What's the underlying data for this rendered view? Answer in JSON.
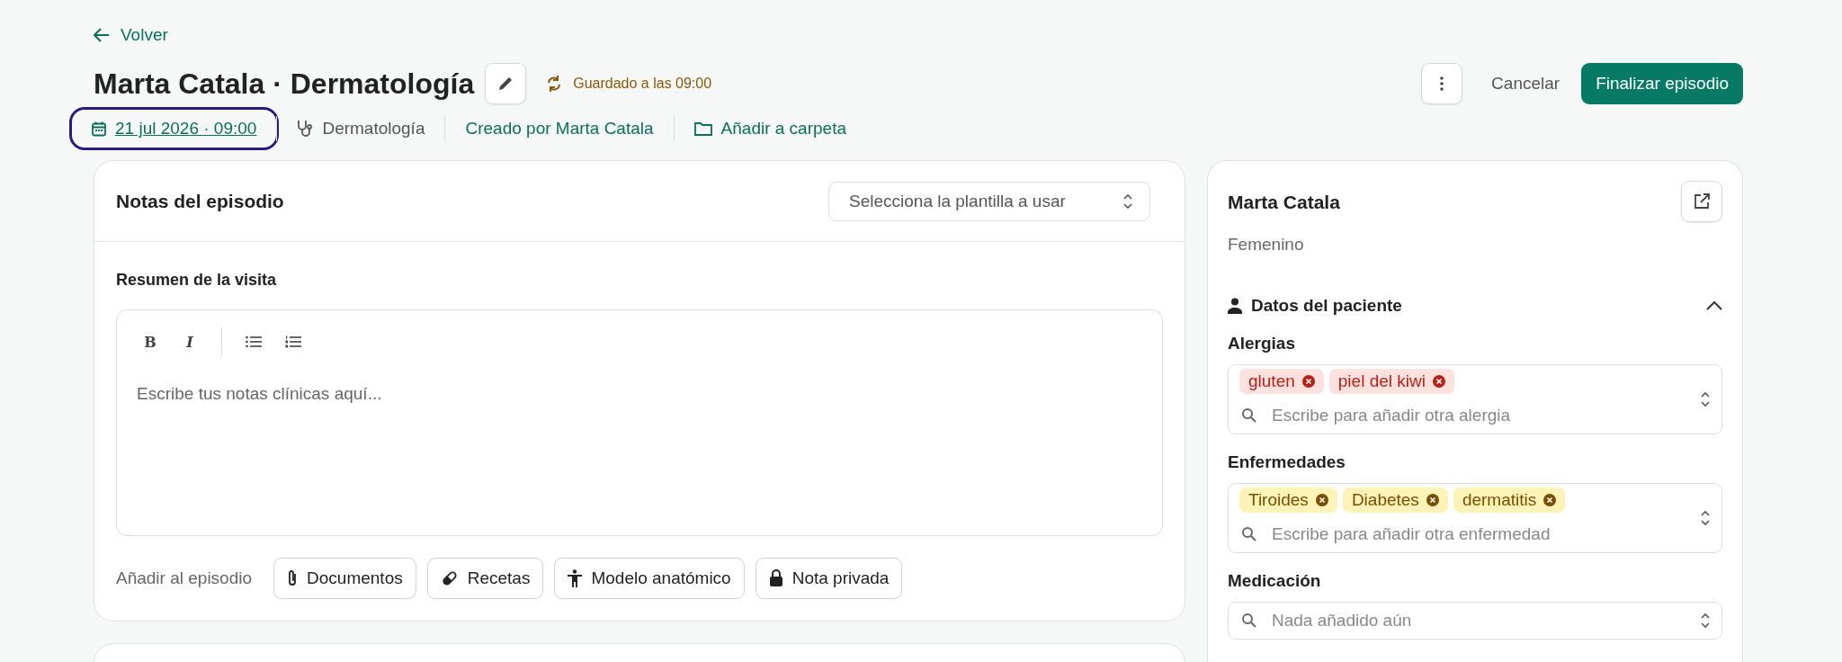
{
  "back_link": {
    "label": "Volver"
  },
  "header": {
    "title": "Marta Catala · Dermatología",
    "save_status": "Guardado a las 09:00",
    "actions": {
      "cancel": "Cancelar",
      "primary": "Finalizar episodio"
    }
  },
  "meta": [
    {
      "kind": "date",
      "label": "21 jul 2026 · 09:00",
      "focused": true
    },
    {
      "kind": "specialty",
      "label": "Dermatología",
      "focused": false
    },
    {
      "kind": "author",
      "label": "Creado por Marta Catala",
      "focused": false
    },
    {
      "kind": "folder",
      "label": "Añadir a carpeta",
      "focused": false
    }
  ],
  "notes_card": {
    "title": "Notas del episodio",
    "template_select": {
      "placeholder": "Selecciona la plantilla a usar"
    },
    "section_label": "Resumen de la visita",
    "editor": {
      "toolbar": [
        {
          "kind": "bold",
          "label": "B"
        },
        {
          "kind": "italic",
          "label": "I"
        },
        {
          "kind": "bullets"
        },
        {
          "kind": "numbered"
        }
      ],
      "placeholder": "Escribe tus notas clínicas aquí..."
    },
    "attach_label": "Añadir al episodio",
    "attach_buttons": [
      {
        "kind": "clip",
        "label": "Documentos"
      },
      {
        "kind": "pill",
        "label": "Recetas"
      },
      {
        "kind": "body",
        "label": "Modelo anatómico"
      },
      {
        "kind": "lock",
        "label": "Nota privada"
      }
    ]
  },
  "patient_card": {
    "name": "Marta Catala",
    "sex": "Femenino",
    "section": {
      "title": "Datos del paciente",
      "expanded": true
    },
    "fields": [
      {
        "label": "Alergias",
        "tags": [
          {
            "label": "gluten",
            "color": "#fde1df"
          },
          {
            "label": "piel del kiwi",
            "color": "#fde1df"
          }
        ],
        "placeholder": "Escribe para añadir otra alergia"
      },
      {
        "label": "Enfermedades",
        "tags": [
          {
            "label": "Tiroides",
            "color": "#fdf3b8"
          },
          {
            "label": "Diabetes",
            "color": "#fdf3b8"
          },
          {
            "label": "dermatitis",
            "color": "#fdf3b8"
          }
        ],
        "placeholder": "Escribe para añadir otra enfermedad"
      },
      {
        "label": "Medicación",
        "placeholder": "Nada añadido aún"
      }
    ]
  }
}
